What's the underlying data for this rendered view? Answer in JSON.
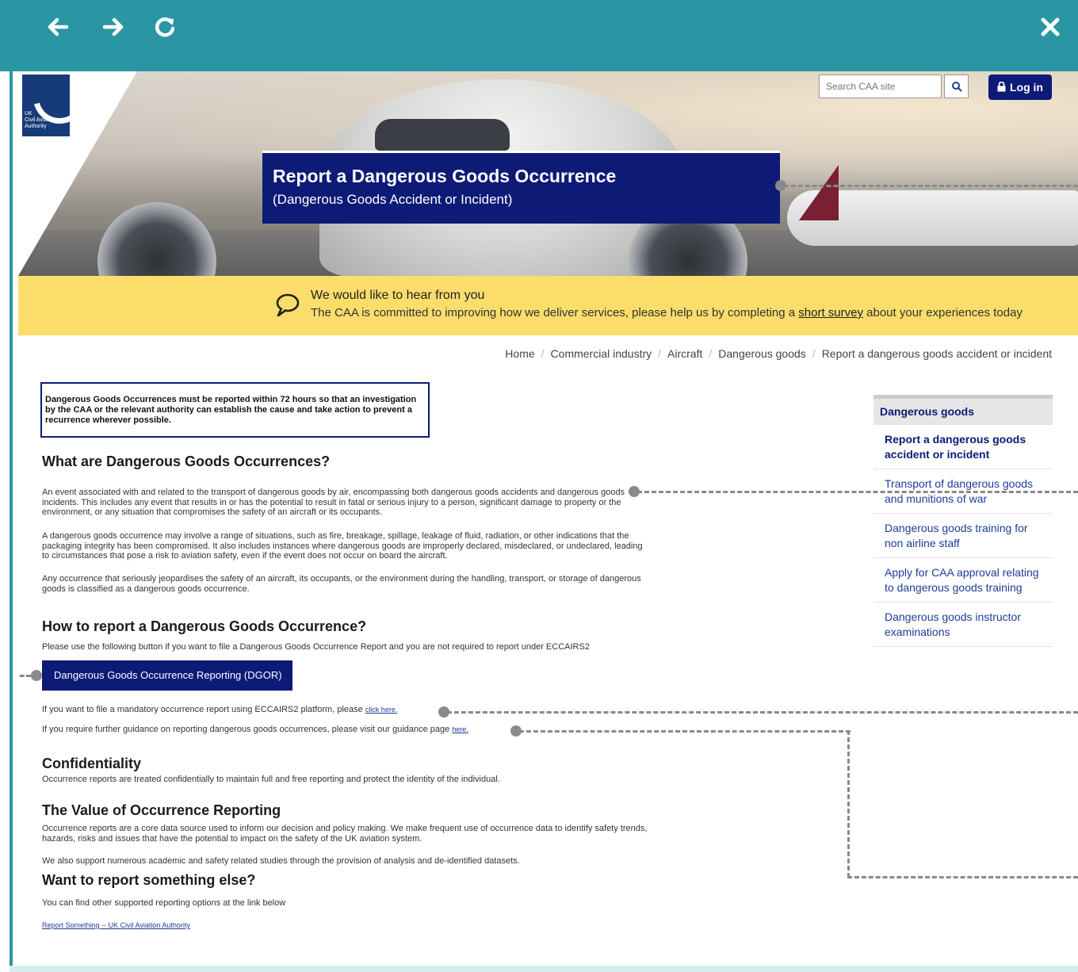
{
  "browser": {
    "back_icon": "arrow-left-icon",
    "forward_icon": "arrow-right-icon",
    "reload_icon": "reload-icon",
    "close_icon": "close-icon",
    "frame_color": "#2a96a3"
  },
  "header": {
    "logo_text": "UK\nCivil Aviation\nAuthority",
    "search_placeholder": "Search CAA site",
    "search_icon": "search-icon",
    "login_label": "Log in",
    "title": "Report a Dangerous Goods Occurrence",
    "subtitle": "(Dangerous Goods Accident or Incident)",
    "brand_color": "#0d1a76"
  },
  "survey_banner": {
    "heading": "We would like to hear from you",
    "text_before": "The CAA is committed to improving how we deliver services, please help us by completing a ",
    "link": "short survey",
    "text_after": " about your experiences today",
    "color": "#fbdd6c"
  },
  "breadcrumb": [
    "Home",
    "Commercial industry",
    "Aircraft",
    "Dangerous goods",
    "Report a dangerous goods accident or incident"
  ],
  "content": {
    "notice": "Dangerous Goods Occurrences must be reported within 72 hours so that an investigation by the CAA or the relevant authority can establish the cause and take action to prevent a recurrence wherever possible.",
    "what_heading": "What are Dangerous Goods Occurrences?",
    "what_p1": "An event associated with and related to the transport of dangerous goods by air, encompassing both dangerous goods accidents and dangerous goods incidents. This includes any event that results in or has the potential to result in fatal or serious injury to a person, significant damage to property or the environment, or any situation that compromises the safety of an aircraft or its occupants.",
    "what_p2": "A dangerous goods occurrence may involve a range of situations, such as fire, breakage, spillage, leakage of fluid, radiation, or other indications that the packaging integrity has been compromised. It also includes instances where dangerous goods are improperly declared, misdeclared, or undeclared, leading to circumstances that pose a risk to aviation safety, even if the event does not occur on board the aircraft.",
    "what_p3": "Any occurrence that seriously jeopardises the safety of an aircraft, its occupants, or the environment during the handling, transport, or storage of dangerous goods is classified as a dangerous goods occurrence.",
    "how_heading": "How to report a Dangerous Goods Occurrence?",
    "how_text": "Please use the following button if you want to file a Dangerous Goods Occurrence Report and you are not required to report under ECCAIRS2",
    "dgor_button": "Dangerous Goods Occurrence Reporting (DGOR)",
    "eccairs_text": "If you want to file a mandatory occurrence report using ECCAIRS2 platform, please ",
    "eccairs_link": "click here.",
    "guidance_text": "If you require further guidance on reporting dangerous goods occurrences, please visit our guidance page ",
    "guidance_link": "here.",
    "conf_heading": "Confidentiality",
    "conf_text": "Occurrence reports are treated confidentially to maintain full and free reporting and protect the identity of the individual.",
    "value_heading": "The Value of Occurrence Reporting",
    "value_p1": "Occurrence reports are a core data source used to inform our decision and policy making. We make frequent use of occurrence data to identify safety trends, hazards, risks and issues that have the potential to impact on the safety of the UK aviation system.",
    "value_p2": "We also support numerous academic and safety related studies through the provision of analysis and de-identified datasets.",
    "else_heading": "Want to report something else?",
    "else_text": "You can find other supported reporting options at the link below",
    "else_link": "Report Something -- UK Civil Aviation Authority"
  },
  "sidebar": {
    "heading": "Dangerous goods",
    "items": [
      {
        "label": "Report a dangerous goods accident or incident",
        "active": true
      },
      {
        "label": "Transport of dangerous goods and munitions of war",
        "active": false
      },
      {
        "label": "Dangerous goods training for non airline staff",
        "active": false
      },
      {
        "label": "Apply for CAA approval relating to dangerous goods training",
        "active": false
      },
      {
        "label": "Dangerous goods instructor examinations",
        "active": false
      }
    ]
  }
}
